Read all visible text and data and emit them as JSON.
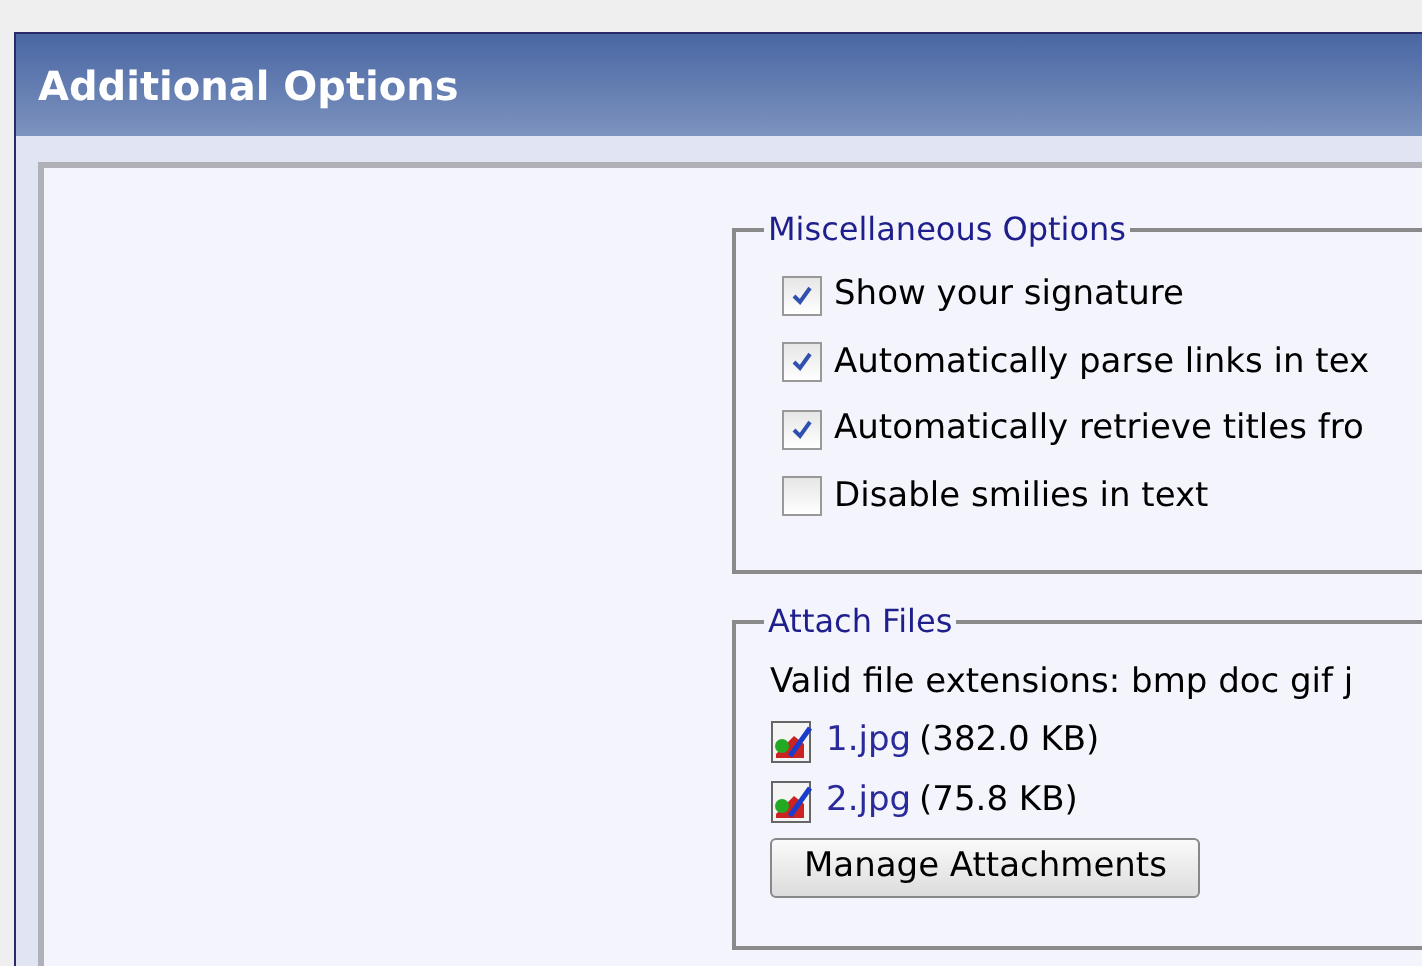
{
  "panel": {
    "title": "Additional Options"
  },
  "misc": {
    "legend": "Miscellaneous Options",
    "options": [
      {
        "label": "Show your signature",
        "checked": true
      },
      {
        "label": "Automatically parse links in tex",
        "checked": true
      },
      {
        "label": "Automatically retrieve titles fro",
        "checked": true
      },
      {
        "label": "Disable smilies in text",
        "checked": false
      }
    ]
  },
  "attach": {
    "legend": "Attach Files",
    "extensions": "Valid file extensions: bmp doc gif j",
    "files": [
      {
        "name": "1.jpg",
        "size": "(382.0 KB)"
      },
      {
        "name": "2.jpg",
        "size": "(75.8 KB)"
      }
    ],
    "button": "Manage Attachments"
  }
}
